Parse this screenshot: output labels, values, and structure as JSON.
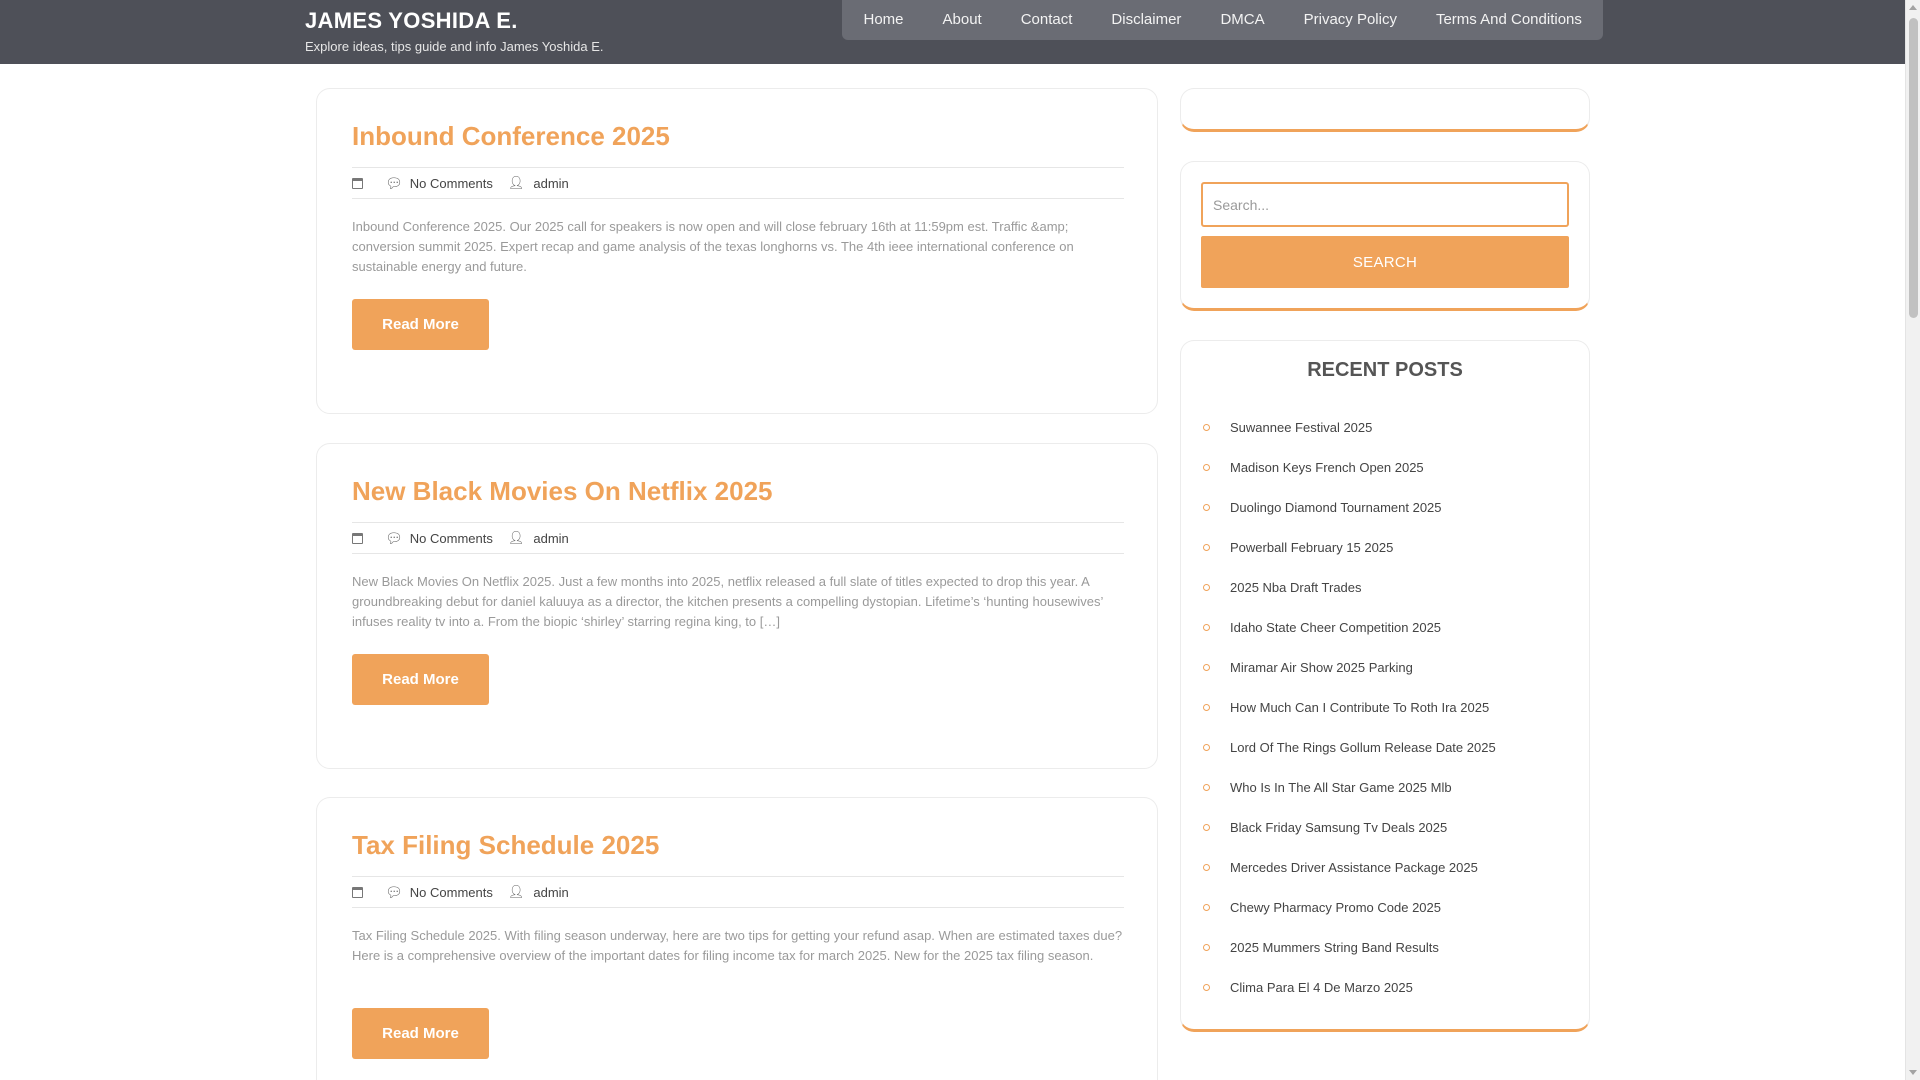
{
  "header": {
    "site_title": "JAMES YOSHIDA E.",
    "tagline": "Explore ideas, tips guide and info James Yoshida E.",
    "nav": [
      "Home",
      "About",
      "Contact",
      "Disclaimer",
      "DMCA",
      "Privacy Policy",
      "Terms And Conditions"
    ]
  },
  "posts": [
    {
      "title": "Inbound Conference 2025",
      "comments": "No Comments",
      "author": "admin",
      "excerpt": "Inbound Conference 2025. Our 2025 call for speakers is now open and will close february 16th at 11:59pm est. Traffic &amp; conversion summit 2025. Expert recap and game analysis of the texas longhorns vs. The 4th ieee international conference on sustainable energy and future.",
      "read_more": "Read More"
    },
    {
      "title": "New Black Movies On Netflix 2025",
      "comments": "No Comments",
      "author": "admin",
      "excerpt": "New Black Movies On Netflix 2025. Just a few months into 2025, netflix released a full slate of titles expected to drop this year. A groundbreaking debut for daniel kaluuya as a director, the kitchen presents a compelling dystopian. Lifetime’s ‘hunting housewives’ infuses reality tv into a. From the biopic ‘shirley’ starring regina king, to […]",
      "read_more": "Read More"
    },
    {
      "title": "Tax Filing Schedule 2025",
      "comments": "No Comments",
      "author": "admin",
      "excerpt": "Tax Filing Schedule 2025. With filing season underway, here are two tips for getting your refund asap. When are estimated taxes due? Here is a comprehensive overview of the important dates for filing income tax for march 2025. New for the 2025 tax filing season.",
      "read_more": "Read More"
    }
  ],
  "sidebar": {
    "search": {
      "placeholder": "Search...",
      "button": "SEARCH"
    },
    "recent_posts": {
      "title": "RECENT POSTS",
      "items": [
        "Suwannee Festival 2025",
        "Madison Keys French Open 2025",
        "Duolingo Diamond Tournament 2025",
        "Powerball February 15 2025",
        "2025 Nba Draft Trades",
        "Idaho State Cheer Competition 2025",
        "Miramar Air Show 2025 Parking",
        "How Much Can I Contribute To Roth Ira 2025",
        "Lord Of The Rings Gollum Release Date 2025",
        "Who Is In The All Star Game 2025 Mlb",
        "Black Friday Samsung Tv Deals 2025",
        "Mercedes Driver Assistance Package 2025",
        "Chewy Pharmacy Promo Code 2025",
        "2025 Mummers String Band Results",
        "Clima Para El 4 De Marzo 2025"
      ]
    }
  },
  "colors": {
    "accent": "#f0a35a",
    "header_bg": "#4e5058",
    "nav_bg": "#6a6c74"
  }
}
